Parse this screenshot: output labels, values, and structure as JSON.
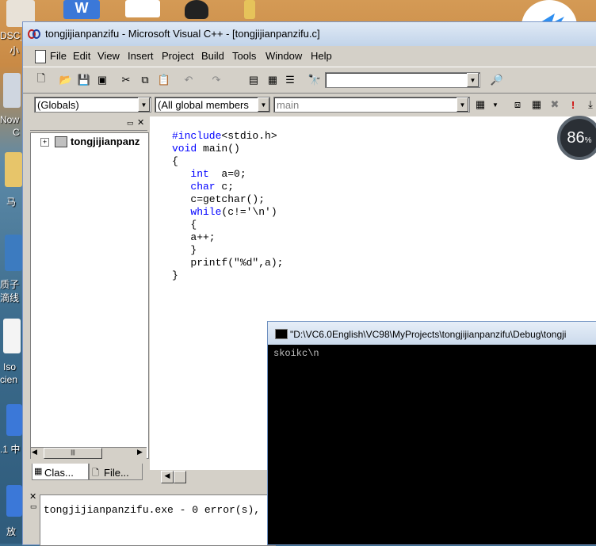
{
  "desktop": {
    "labels": [
      "DSC_",
      "小",
      "Now",
      "C",
      "马",
      "质子",
      "滴线",
      "Iso",
      "cien",
      ".1 中",
      "放"
    ]
  },
  "window": {
    "title": "tongjijianpanzifu - Microsoft Visual C++ - [tongjijianpanzifu.c]"
  },
  "menu": [
    "File",
    "Edit",
    "View",
    "Insert",
    "Project",
    "Build",
    "Tools",
    "Window",
    "Help"
  ],
  "wizard_bar": {
    "scope": "(Globals)",
    "members": "(All global members",
    "function": "main"
  },
  "workspace": {
    "tree_item": "tongjijianpanz",
    "tabs": [
      "Clas...",
      "File..."
    ]
  },
  "code_lines": [
    "#include<stdio.h>",
    "void main()",
    "{",
    "   int  a=0;",
    "   char c;",
    "   c=getchar();",
    "   while(c!='\\n')",
    "   {",
    "   a++;",
    "   }",
    "   printf(\"%d\",a);",
    "",
    "}"
  ],
  "output": {
    "text": "tongjijianpanzifu.exe - 0 error(s),"
  },
  "console": {
    "title": "\"D:\\VC6.0English\\VC98\\MyProjects\\tongjijianpanzifu\\Debug\\tongji",
    "text": "skoikc\\n"
  },
  "badge": {
    "value": "86",
    "unit": "%"
  },
  "colors": {
    "keyword": "#0000ff",
    "console_bg": "#000000"
  }
}
